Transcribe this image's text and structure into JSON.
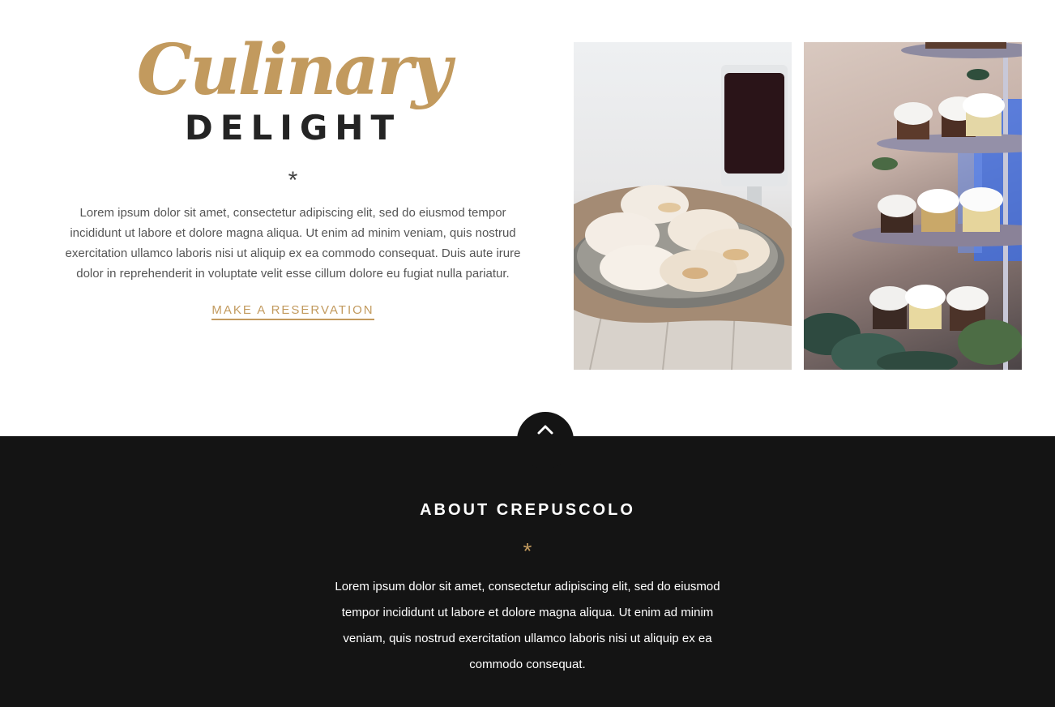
{
  "hero": {
    "script_title": "Culinary",
    "bold_title": "DELIGHT",
    "ornament": "*",
    "body": "Lorem ipsum dolor sit amet, consectetur adipiscing elit, sed do eiusmod tempor incididunt ut labore et dolore magna aliqua. Ut enim ad minim veniam, quis nostrud exercitation ullamco laboris nisi ut aliquip ex ea commodo consequat. Duis aute irure dolor in reprehenderit in voluptate velit esse cillum dolore eu fugiat nulla pariatur.",
    "cta_label": "MAKE A RESERVATION"
  },
  "gallery": {
    "images": [
      {
        "subject": "cookies-and-coffee"
      },
      {
        "subject": "cupcake-tower"
      }
    ]
  },
  "scroll_top": {
    "icon": "chevron-up-icon"
  },
  "about": {
    "title": "ABOUT CREPUSCOLO",
    "ornament": "*",
    "body": "Lorem ipsum dolor sit amet, consectetur adipiscing elit, sed do eiusmod tempor incididunt ut labore et dolore magna aliqua. Ut enim ad minim veniam, quis nostrud exercitation ullamco laboris nisi ut aliquip ex ea commodo consequat."
  },
  "colors": {
    "accent": "#c29a5e",
    "dark_bg": "#141414",
    "heading": "#242424"
  }
}
